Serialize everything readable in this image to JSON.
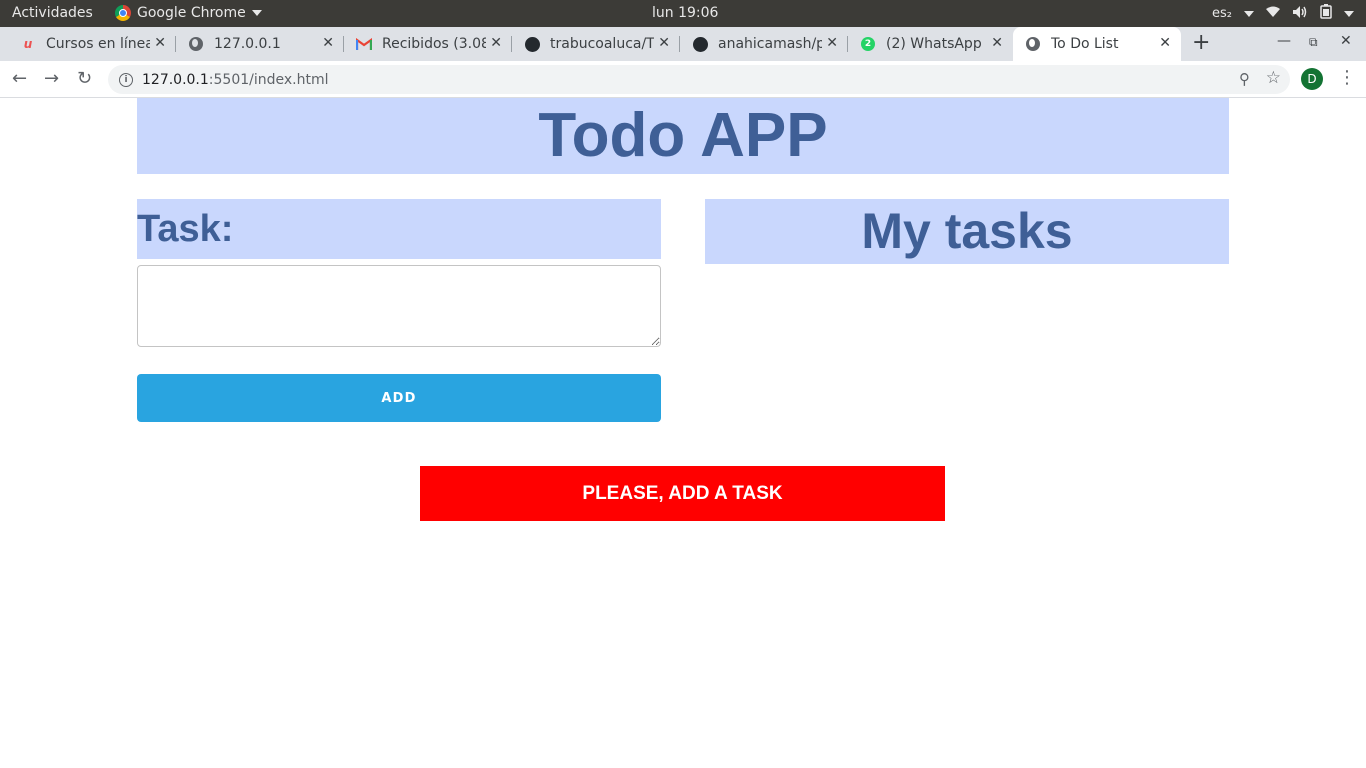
{
  "system_bar": {
    "activities": "Actividades",
    "app_name": "Google Chrome",
    "clock": "lun 19:06",
    "keyboard_layout": "es₂"
  },
  "tabs": [
    {
      "title": "Cursos en línea",
      "icon": "udemy-icon",
      "active": false
    },
    {
      "title": "127.0.0.1",
      "icon": "globe-icon",
      "active": false
    },
    {
      "title": "Recibidos (3.08",
      "icon": "gmail-icon",
      "active": false
    },
    {
      "title": "trabucoaluca/T",
      "icon": "github-icon",
      "active": false
    },
    {
      "title": "anahicamash/p",
      "icon": "github-icon",
      "active": false
    },
    {
      "title": "(2) WhatsApp",
      "icon": "whatsapp-icon",
      "badge": "2",
      "active": false
    },
    {
      "title": "To Do List",
      "icon": "globe-icon",
      "active": true
    }
  ],
  "address_bar": {
    "host": "127.0.0.1",
    "path": ":5501/index.html"
  },
  "profile": {
    "initial": "D",
    "color": "#137333"
  },
  "app": {
    "title": "Todo APP",
    "task_label": "Task:",
    "task_input_value": "",
    "add_button": "ADD",
    "my_tasks_title": "My tasks",
    "alert": "PLEASE, ADD A TASK"
  },
  "colors": {
    "header_bg": "#c9d7fd",
    "header_text": "#3f5f96",
    "add_button": "#29a4e0",
    "alert_bg": "#ff0000"
  }
}
